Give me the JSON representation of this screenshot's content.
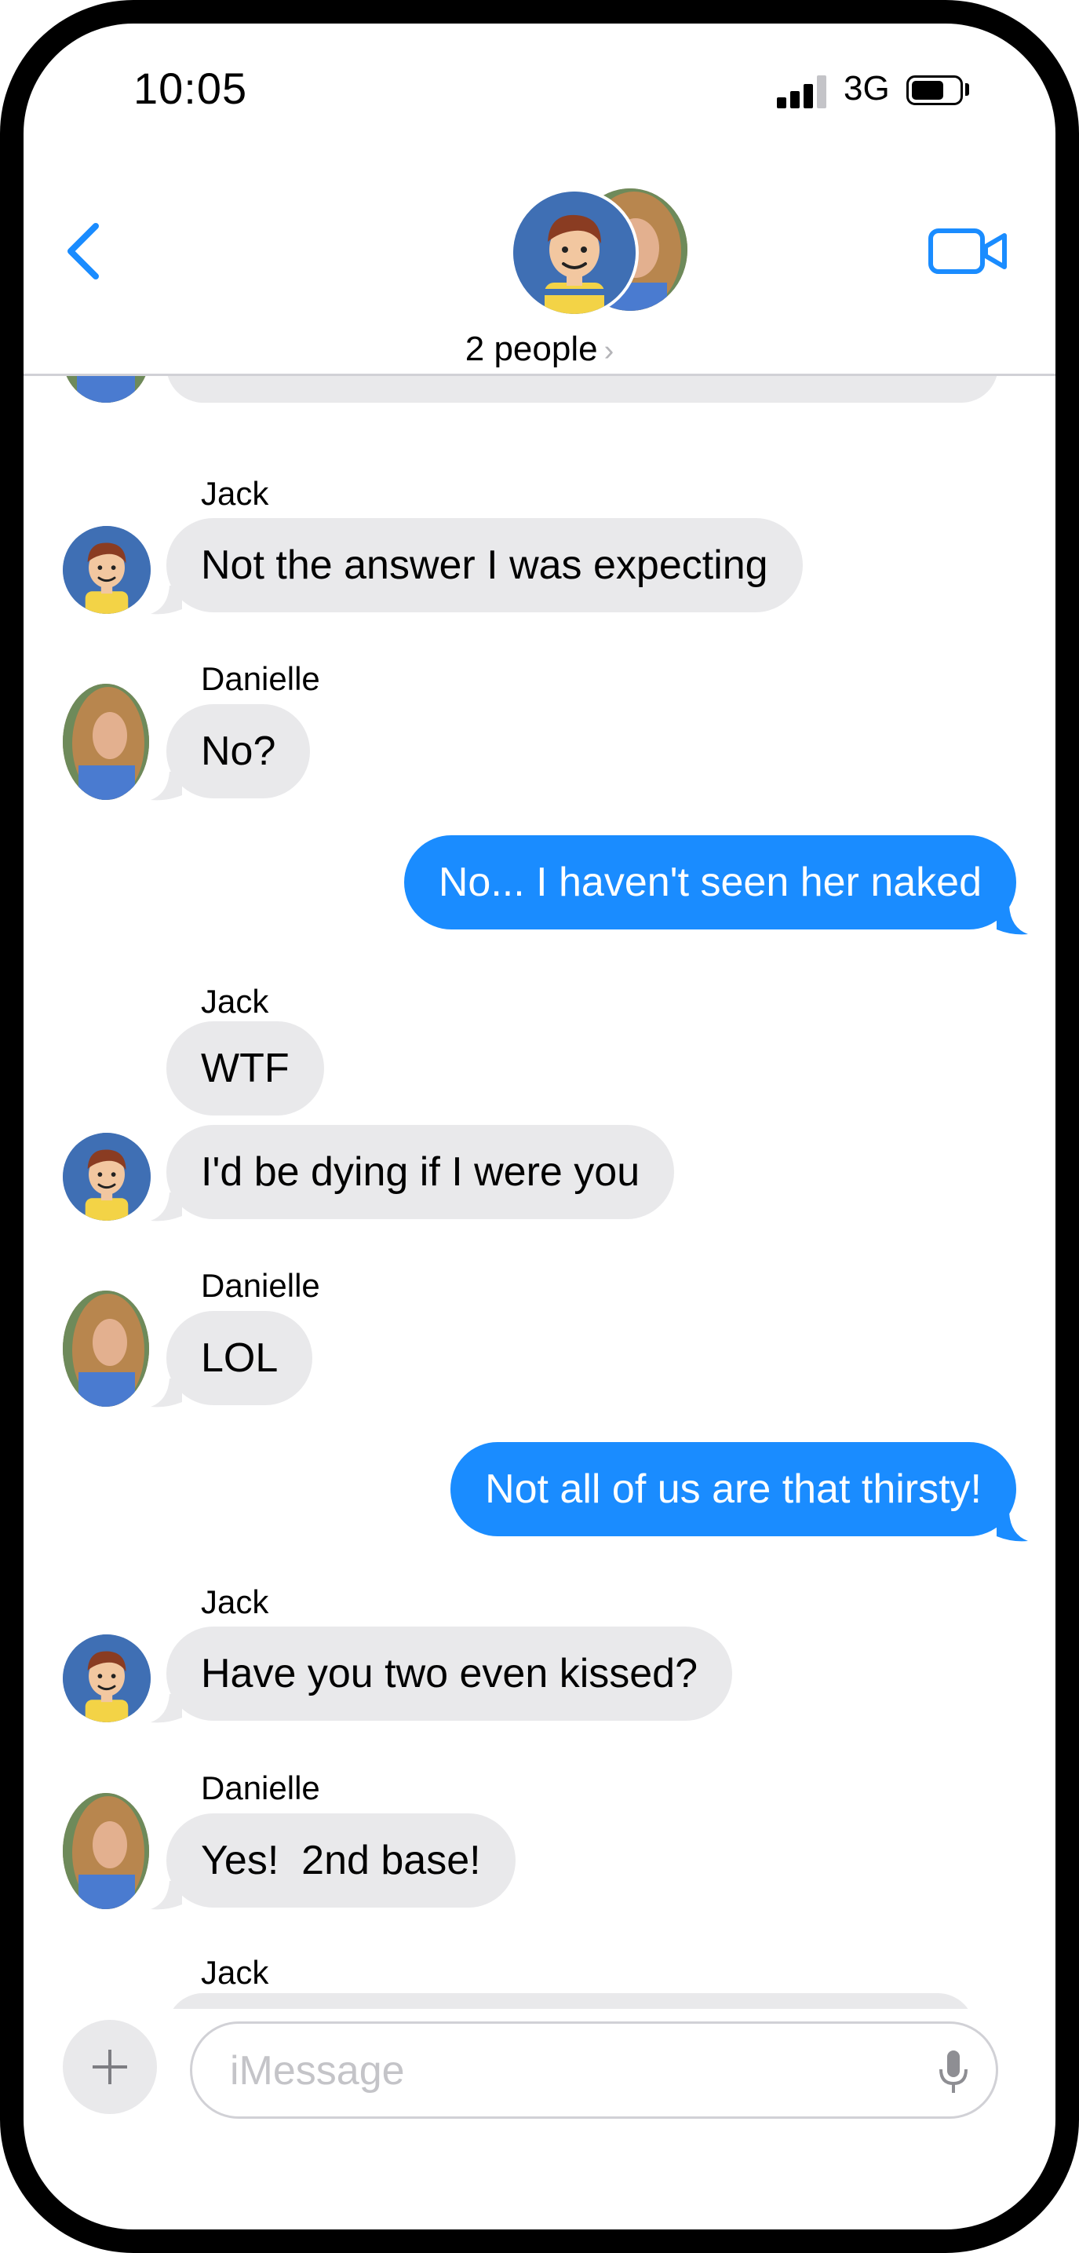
{
  "status_bar": {
    "time": "10:05",
    "network": "3G",
    "icons": [
      "signal-bars-icon",
      "battery-icon"
    ]
  },
  "header": {
    "back_icon": "chevron-left-icon",
    "video_icon": "video-camera-icon",
    "group_label": "2 people",
    "group_chevron": "›",
    "accent": "#1a8cff"
  },
  "messages": [
    {
      "sender": "Jack",
      "text": "Not the answer I was expecting",
      "direction": "incoming"
    },
    {
      "sender": "Danielle",
      "text": "No?",
      "direction": "incoming"
    },
    {
      "sender": "",
      "text": "No... I haven't seen her naked",
      "direction": "outgoing"
    },
    {
      "sender": "Jack",
      "text": "WTF",
      "direction": "incoming"
    },
    {
      "sender": "",
      "text": "I'd be dying if I were you",
      "direction": "incoming"
    },
    {
      "sender": "Danielle",
      "text": "LOL",
      "direction": "incoming"
    },
    {
      "sender": "",
      "text": "Not all of us are that thirsty!",
      "direction": "outgoing"
    },
    {
      "sender": "Jack",
      "text": "Have you two even kissed?",
      "direction": "incoming"
    },
    {
      "sender": "Danielle",
      "text": "Yes!  2nd base!",
      "direction": "incoming"
    },
    {
      "sender": "Jack",
      "text": "",
      "direction": "incoming"
    }
  ],
  "composer": {
    "placeholder": "iMessage",
    "plus_icon": "plus-icon",
    "mic_icon": "microphone-icon"
  },
  "colors": {
    "incoming_bubble": "#e9e9eb",
    "outgoing_bubble": "#1a8cff",
    "jack_avatar": "#3f6fb4"
  }
}
